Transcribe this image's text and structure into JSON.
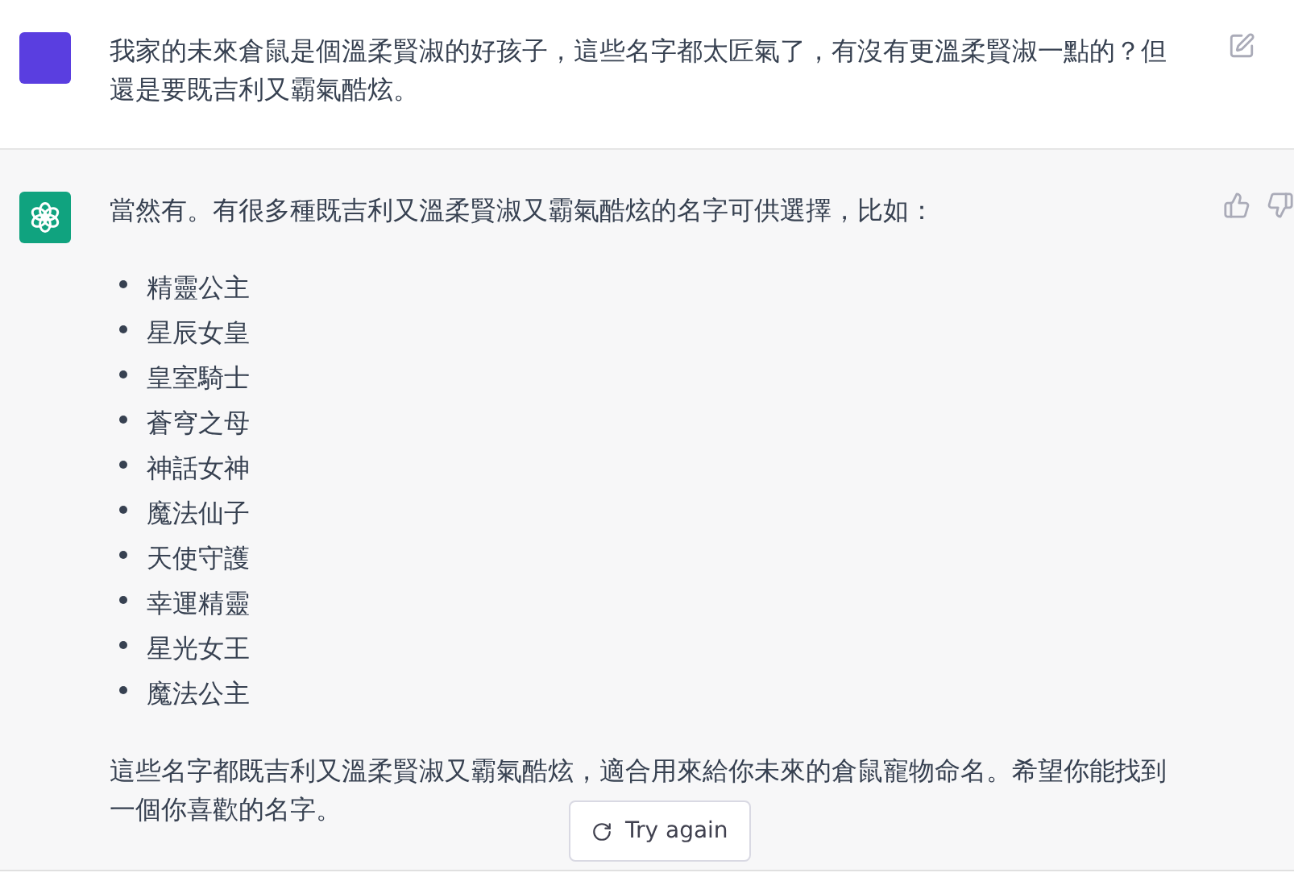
{
  "messages": [
    {
      "kind": "user",
      "text": "我家的未來倉鼠是個溫柔賢淑的好孩子，這些名字都太匠氣了，有沒有更溫柔賢淑一點的？但還是要既吉利又霸氣酷炫。"
    },
    {
      "kind": "assistant",
      "intro": "當然有。有很多種既吉利又溫柔賢淑又霸氣酷炫的名字可供選擇，比如：",
      "items": [
        "精靈公主",
        "星辰女皇",
        "皇室騎士",
        "蒼穹之母",
        "神話女神",
        "魔法仙子",
        "天使守護",
        "幸運精靈",
        "星光女王",
        "魔法公主"
      ],
      "outro": "這些名字都既吉利又溫柔賢淑又霸氣酷炫，適合用來給你未來的倉鼠寵物命名。希望你能找到一個你喜歡的名字。"
    }
  ],
  "try_again": {
    "label": "Try again"
  }
}
